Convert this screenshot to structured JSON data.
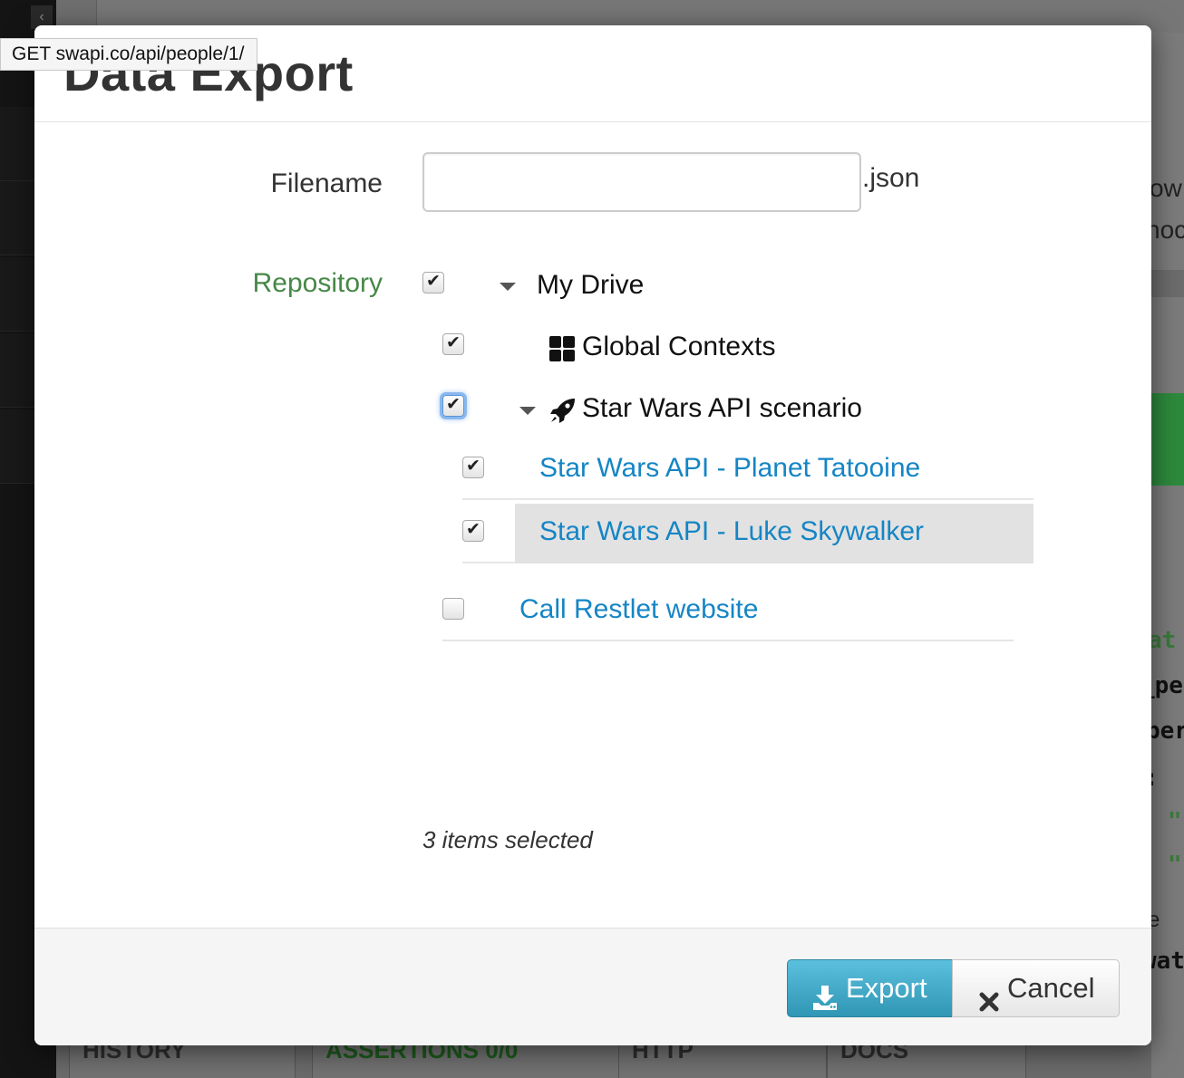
{
  "tooltip": {
    "text": "GET swapi.co/api/people/1/"
  },
  "modal": {
    "title": "Data Export",
    "filename": {
      "label": "Filename",
      "value": "",
      "placeholder": "",
      "suffix": ".json"
    },
    "repository": {
      "label": "Repository",
      "tree": {
        "root": {
          "label": "My Drive",
          "checked": true,
          "expanded": true,
          "caret_icon": "caret-down-icon"
        },
        "global_contexts": {
          "label": "Global Contexts",
          "checked": true,
          "icon": "grid-icon"
        },
        "scenario": {
          "label": "Star Wars API scenario",
          "checked": true,
          "expanded": true,
          "focused": true,
          "icon": "rocket-icon",
          "caret_icon": "caret-down-icon",
          "children": [
            {
              "label": "Star Wars API - Planet Tatooine",
              "checked": true
            },
            {
              "label": "Star Wars API - Luke Skywalker",
              "checked": true,
              "hovered": true
            }
          ]
        },
        "restlet": {
          "label": "Call Restlet website",
          "checked": false
        }
      }
    },
    "status": "3 items selected",
    "buttons": {
      "export": {
        "label": "Export",
        "icon": "download-icon"
      },
      "cancel": {
        "label": "Cancel",
        "icon": "close-icon"
      }
    }
  },
  "background": {
    "right_edge_text": [
      "ow",
      "noc"
    ],
    "right_edge_code": [
      "at",
      "_pe",
      "per",
      ":",
      "\"",
      "\"",
      "e",
      "wat"
    ],
    "bottom_tabs": [
      "HISTORY",
      "ASSERTIONS 0/0",
      "HTTP",
      "DOCS"
    ],
    "colors": {
      "success_band": "#2d8a3d",
      "link": "#1585c5",
      "repo_label": "#468847",
      "export_button": "#2f96b4"
    }
  }
}
